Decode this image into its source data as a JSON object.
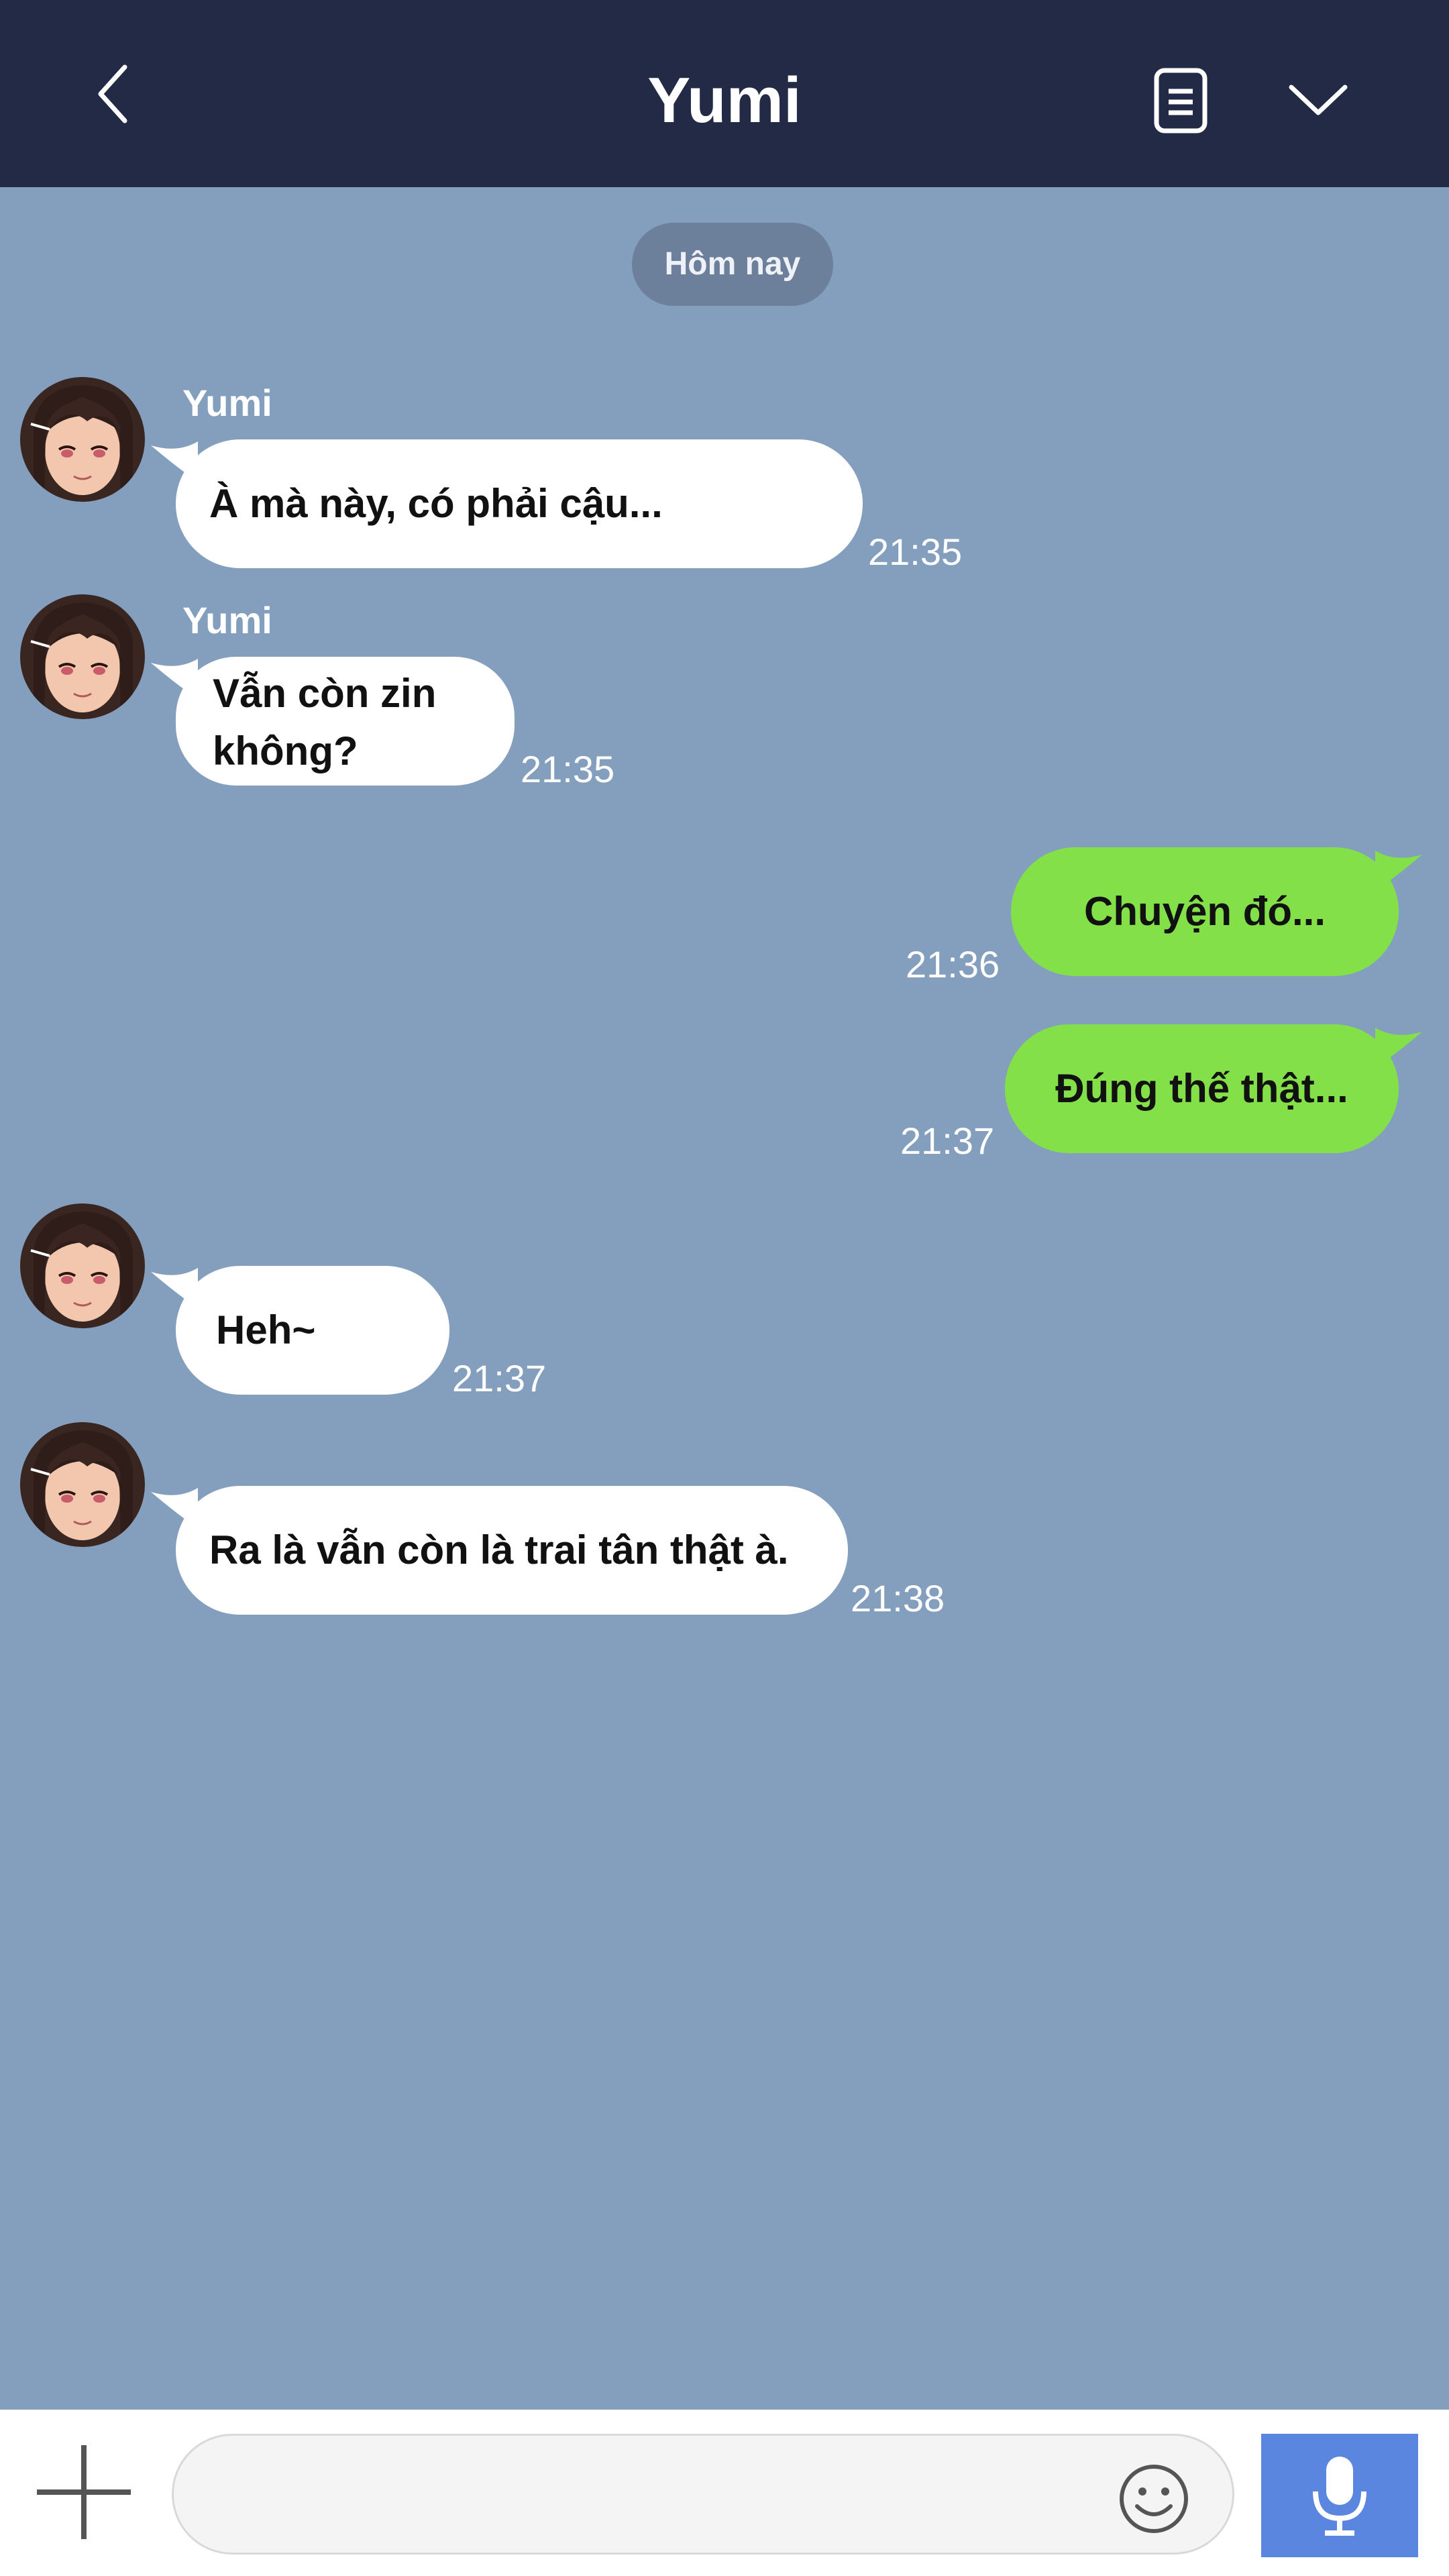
{
  "header": {
    "title": "Yumi",
    "icons": [
      "chevron-left-icon",
      "notes-icon",
      "chevron-down-icon"
    ],
    "background": "#232a45"
  },
  "chat": {
    "background": "#849fbe",
    "date_label": "Hôm nay",
    "messages": [
      {
        "direction": "in",
        "sender": "Yumi",
        "text": "À mà này, có phải cậu...",
        "time": "21:35"
      },
      {
        "direction": "in",
        "sender": "Yumi",
        "text_line1": "Vẫn còn zin",
        "text_line2": "không?",
        "time": "21:35"
      },
      {
        "direction": "out",
        "text": "Chuyện đó...",
        "time": "21:36"
      },
      {
        "direction": "out",
        "text": "Đúng thế thật...",
        "time": "21:37"
      },
      {
        "direction": "in",
        "text": "Heh~",
        "time": "21:37"
      },
      {
        "direction": "in",
        "text": "Ra là vẫn còn là trai tân thật à.",
        "time": "21:38"
      }
    ],
    "colors": {
      "incoming_bubble": "#ffffff",
      "outgoing_bubble": "#83e048"
    }
  },
  "composer": {
    "placeholder": "",
    "icons": [
      "plus-icon",
      "emoji-icon",
      "microphone-icon"
    ],
    "mic_color": "#5a86e0"
  }
}
